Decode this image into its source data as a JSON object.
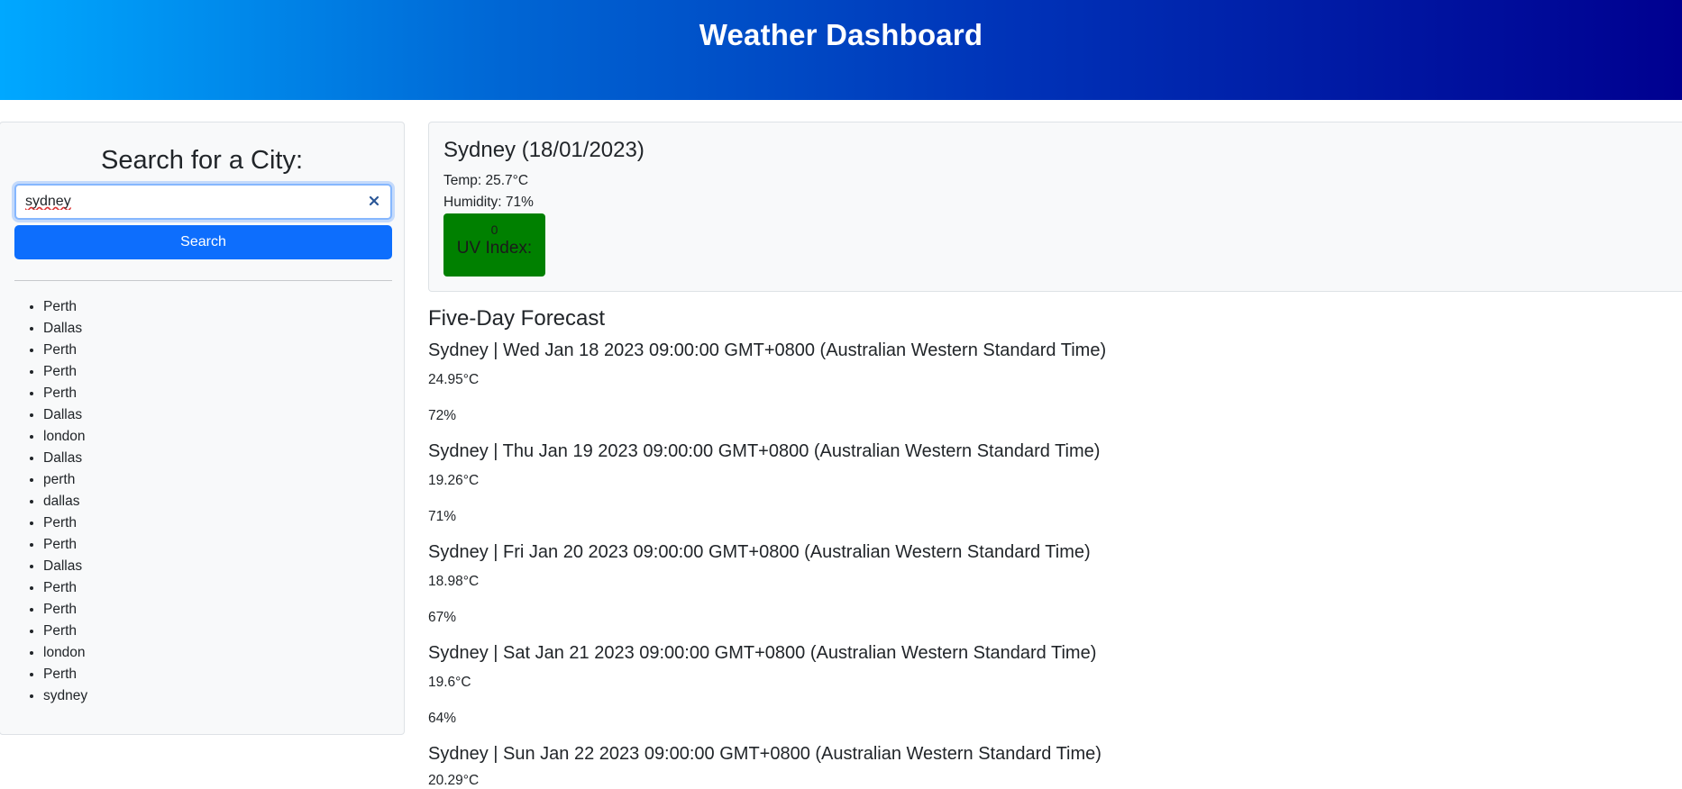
{
  "header": {
    "title": "Weather Dashboard",
    "gradient_colors": [
      "#00a8ff",
      "#000090"
    ]
  },
  "sidebar": {
    "heading": "Search for a City:",
    "search": {
      "value": "sydney",
      "placeholder": ""
    },
    "search_button_label": "Search",
    "clear_icon": "close-icon",
    "history": [
      "Perth",
      "Dallas",
      "Perth",
      "Perth",
      "Perth",
      "Dallas",
      "london",
      "Dallas",
      "perth",
      "dallas",
      "Perth",
      "Perth",
      "Dallas",
      "Perth",
      "Perth",
      "Perth",
      "london",
      "Perth",
      "sydney"
    ]
  },
  "current": {
    "title": "Sydney (18/01/2023)",
    "temp": "Temp: 25.7°C",
    "humidity": "Humidity: 71%",
    "uv_value": "0",
    "uv_label": "UV Index:",
    "uv_color": "#008000"
  },
  "forecast": {
    "title": "Five-Day Forecast",
    "days": [
      {
        "heading": "Sydney | Wed Jan 18 2023 09:00:00 GMT+0800 (Australian Western Standard Time)",
        "temp": "24.95°C",
        "humidity": "72%"
      },
      {
        "heading": "Sydney | Thu Jan 19 2023 09:00:00 GMT+0800 (Australian Western Standard Time)",
        "temp": "19.26°C",
        "humidity": "71%"
      },
      {
        "heading": "Sydney | Fri Jan 20 2023 09:00:00 GMT+0800 (Australian Western Standard Time)",
        "temp": "18.98°C",
        "humidity": "67%"
      },
      {
        "heading": "Sydney | Sat Jan 21 2023 09:00:00 GMT+0800 (Australian Western Standard Time)",
        "temp": "19.6°C",
        "humidity": "64%"
      },
      {
        "heading": "Sydney | Sun Jan 22 2023 09:00:00 GMT+0800 (Australian Western Standard Time)",
        "temp": "20.29°C",
        "humidity": ""
      }
    ]
  }
}
